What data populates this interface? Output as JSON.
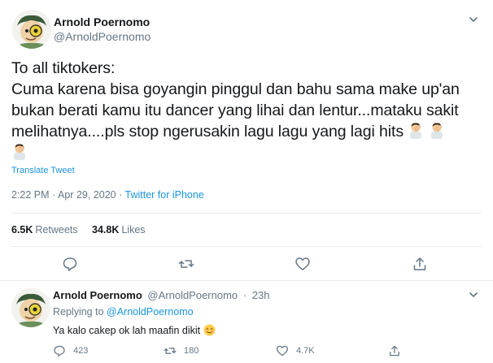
{
  "main_tweet": {
    "author_name": "Arnold Poernomo",
    "author_handle": "@ArnoldPoernomo",
    "text_lines": [
      "To all tiktokers:",
      "Cuma karena bisa goyangin pinggul dan bahu sama make up'an",
      "bukan berati kamu itu dancer yang lihai dan lentur...mataku sakit",
      "melihatnya....pls stop ngerusakin lagu lagu yang lagi hits"
    ],
    "emoji": "man-facepalming-emoji",
    "translate_label": "Translate Tweet",
    "time": "2:22 PM",
    "date": "Apr 29, 2020",
    "separator": "·",
    "source": "Twitter for iPhone",
    "retweets_count": "6.5K",
    "retweets_label": "Retweets",
    "likes_count": "34.8K",
    "likes_label": "Likes"
  },
  "reply_tweet": {
    "author_name": "Arnold Poernomo",
    "author_handle": "@ArnoldPoernomo",
    "separator": "·",
    "time": "23h",
    "replying_prefix": "Replying to",
    "replying_to": "@ArnoldPoernomo",
    "text": "Ya kalo cakep ok lah maafin dikit",
    "emoji": "relieved-face-emoji",
    "reply_count": "423",
    "retweet_count": "180",
    "like_count": "4.7K"
  },
  "colors": {
    "text": "#14171a",
    "secondary": "#657786",
    "link": "#1b95e0",
    "divider": "#e6ecf0"
  }
}
